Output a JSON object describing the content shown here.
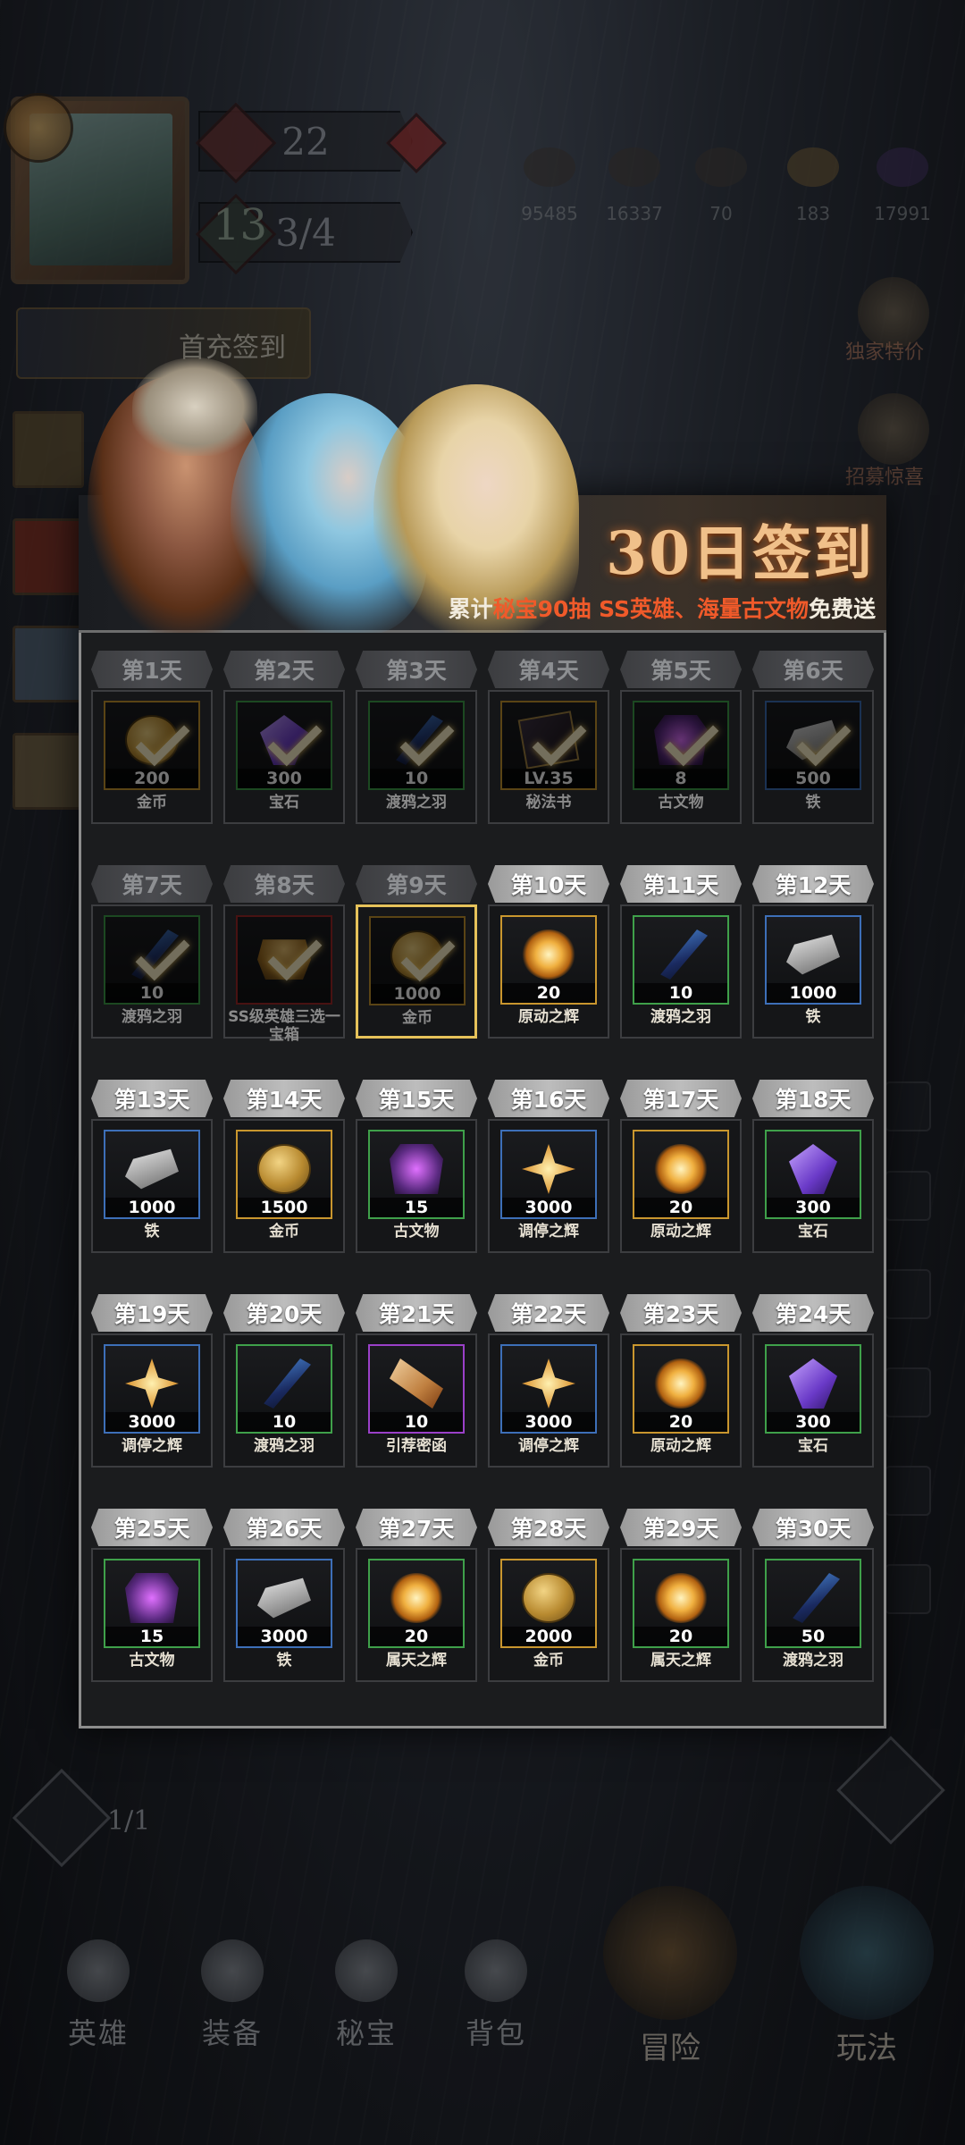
{
  "hud": {
    "power_value": "22",
    "level_value": "13",
    "stamina": "3/4",
    "resources": [
      "95485",
      "16337",
      "70",
      "183",
      "17991"
    ],
    "first_charge_label": "首充签到",
    "right_labels": [
      "独家特价",
      "招募惊喜"
    ],
    "portal_fraction": "1/1"
  },
  "popup": {
    "title": "30日签到",
    "subtitle_prefix": "累计",
    "subtitle_hl1": "秘宝90抽",
    "subtitle_hl2": "SS英雄、海量古文物",
    "subtitle_suffix": "免费送"
  },
  "days": [
    {
      "day": "第1天",
      "qty": "200",
      "name": "金币",
      "icon": "coin-icon",
      "rarity": "gold",
      "claimed": true
    },
    {
      "day": "第2天",
      "qty": "300",
      "name": "宝石",
      "icon": "gem-icon",
      "rarity": "green",
      "claimed": true
    },
    {
      "day": "第3天",
      "qty": "10",
      "name": "渡鸦之羽",
      "icon": "feather-icon",
      "rarity": "green",
      "claimed": true
    },
    {
      "day": "第4天",
      "qty": "LV.35",
      "name": "秘法书",
      "icon": "book-icon",
      "rarity": "gold",
      "claimed": true
    },
    {
      "day": "第5天",
      "qty": "8",
      "name": "古文物",
      "icon": "relic-icon",
      "rarity": "green",
      "claimed": true
    },
    {
      "day": "第6天",
      "qty": "500",
      "name": "铁",
      "icon": "iron-icon",
      "rarity": "blue",
      "claimed": true
    },
    {
      "day": "第7天",
      "qty": "10",
      "name": "渡鸦之羽",
      "icon": "feather-icon",
      "rarity": "green",
      "claimed": true
    },
    {
      "day": "第8天",
      "qty": "",
      "name": "SS级英雄三选一宝箱",
      "icon": "chest-icon",
      "rarity": "red",
      "claimed": true
    },
    {
      "day": "第9天",
      "qty": "1000",
      "name": "金币",
      "icon": "coin-icon",
      "rarity": "gold",
      "claimed": true,
      "today": true
    },
    {
      "day": "第10天",
      "qty": "20",
      "name": "原动之辉",
      "icon": "sun-icon",
      "rarity": "gold",
      "claimed": false
    },
    {
      "day": "第11天",
      "qty": "10",
      "name": "渡鸦之羽",
      "icon": "feather-icon",
      "rarity": "green",
      "claimed": false
    },
    {
      "day": "第12天",
      "qty": "1000",
      "name": "铁",
      "icon": "iron-icon",
      "rarity": "blue",
      "claimed": false
    },
    {
      "day": "第13天",
      "qty": "1000",
      "name": "铁",
      "icon": "iron-icon",
      "rarity": "blue",
      "claimed": false
    },
    {
      "day": "第14天",
      "qty": "1500",
      "name": "金币",
      "icon": "coin-icon",
      "rarity": "gold",
      "claimed": false
    },
    {
      "day": "第15天",
      "qty": "15",
      "name": "古文物",
      "icon": "relic-icon",
      "rarity": "green",
      "claimed": false
    },
    {
      "day": "第16天",
      "qty": "3000",
      "name": "调停之辉",
      "icon": "star-icon",
      "rarity": "blue",
      "claimed": false
    },
    {
      "day": "第17天",
      "qty": "20",
      "name": "原动之辉",
      "icon": "sun-icon",
      "rarity": "gold",
      "claimed": false
    },
    {
      "day": "第18天",
      "qty": "300",
      "name": "宝石",
      "icon": "gem-icon",
      "rarity": "green",
      "claimed": false
    },
    {
      "day": "第19天",
      "qty": "3000",
      "name": "调停之辉",
      "icon": "star-icon",
      "rarity": "blue",
      "claimed": false
    },
    {
      "day": "第20天",
      "qty": "10",
      "name": "渡鸦之羽",
      "icon": "feather-icon",
      "rarity": "green",
      "claimed": false
    },
    {
      "day": "第21天",
      "qty": "10",
      "name": "引荐密函",
      "icon": "scroll-icon",
      "rarity": "purple",
      "claimed": false
    },
    {
      "day": "第22天",
      "qty": "3000",
      "name": "调停之辉",
      "icon": "star-icon",
      "rarity": "blue",
      "claimed": false
    },
    {
      "day": "第23天",
      "qty": "20",
      "name": "原动之辉",
      "icon": "sun-icon",
      "rarity": "gold",
      "claimed": false
    },
    {
      "day": "第24天",
      "qty": "300",
      "name": "宝石",
      "icon": "gem-icon",
      "rarity": "green",
      "claimed": false
    },
    {
      "day": "第25天",
      "qty": "15",
      "name": "古文物",
      "icon": "relic-icon",
      "rarity": "green",
      "claimed": false
    },
    {
      "day": "第26天",
      "qty": "3000",
      "name": "铁",
      "icon": "iron-icon",
      "rarity": "blue",
      "claimed": false
    },
    {
      "day": "第27天",
      "qty": "20",
      "name": "属天之辉",
      "icon": "sun-icon",
      "rarity": "green",
      "claimed": false
    },
    {
      "day": "第28天",
      "qty": "2000",
      "name": "金币",
      "icon": "coin-icon",
      "rarity": "gold",
      "claimed": false
    },
    {
      "day": "第29天",
      "qty": "20",
      "name": "属天之辉",
      "icon": "sun-icon",
      "rarity": "green",
      "claimed": false
    },
    {
      "day": "第30天",
      "qty": "50",
      "name": "渡鸦之羽",
      "icon": "feather-icon",
      "rarity": "green",
      "claimed": false
    }
  ],
  "nav": [
    {
      "label": "英雄",
      "icon": "hero-icon"
    },
    {
      "label": "装备",
      "icon": "equipment-icon"
    },
    {
      "label": "秘宝",
      "icon": "treasure-icon"
    },
    {
      "label": "背包",
      "icon": "bag-icon"
    },
    {
      "label": "冒险",
      "icon": "adventure-icon"
    },
    {
      "label": "玩法",
      "icon": "portal-icon"
    }
  ]
}
